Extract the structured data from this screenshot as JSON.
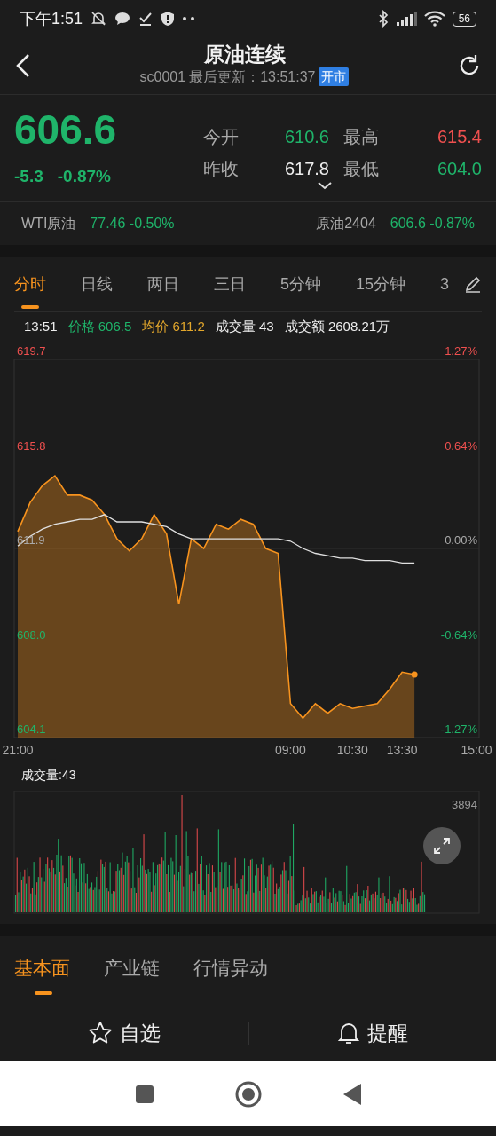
{
  "status_bar": {
    "time": "下午1:51",
    "battery": "56"
  },
  "header": {
    "title": "原油连续",
    "code": "sc0001",
    "update_label": "最后更新：13:51:37",
    "badge": "开市"
  },
  "quote": {
    "price": "606.6",
    "change": "-5.3",
    "change_pct": "-0.87%",
    "color": "#1fb46a",
    "fields": [
      {
        "label": "今开",
        "value": "610.6",
        "color": "#1fb46a"
      },
      {
        "label": "最高",
        "value": "615.4",
        "color": "#f0504f"
      },
      {
        "label": "昨收",
        "value": "617.8",
        "color": "#eeeeee"
      },
      {
        "label": "最低",
        "value": "604.0",
        "color": "#1fb46a"
      }
    ]
  },
  "related": [
    {
      "name": "WTI原油",
      "value": "77.46 -0.50%",
      "color": "#1fb46a"
    },
    {
      "name": "原油2404",
      "value": "606.6 -0.87%",
      "color": "#1fb46a"
    }
  ],
  "period_tabs": [
    {
      "label": "分时",
      "selected": true
    },
    {
      "label": "日线",
      "selected": false
    },
    {
      "label": "两日",
      "selected": false
    },
    {
      "label": "三日",
      "selected": false
    },
    {
      "label": "5分钟",
      "selected": false
    },
    {
      "label": "15分钟",
      "selected": false
    },
    {
      "label": "3",
      "selected": false
    }
  ],
  "info_row": [
    {
      "text": "13:51",
      "kind": "plain"
    },
    {
      "text": "价格 606.5",
      "kind": "price"
    },
    {
      "text": "均价 611.2",
      "kind": "avg"
    },
    {
      "text": "成交量 43",
      "kind": "plain"
    },
    {
      "text": "成交额 2608.21万",
      "kind": "plain"
    }
  ],
  "chart": {
    "right_labels": [
      "1.27%",
      "0.64%",
      "0.00%",
      "-0.64%",
      "-1.27%"
    ],
    "chart_data": {
      "type": "line",
      "grid": true,
      "ylim": [
        604.1,
        619.7
      ],
      "yticks": [
        {
          "value": 619.7,
          "label": "619.7"
        },
        {
          "value": 615.8,
          "label": "615.8"
        },
        {
          "value": 611.9,
          "label": "611.9"
        },
        {
          "value": 608.0,
          "label": "608.0"
        },
        {
          "value": 604.1,
          "label": "604.1"
        }
      ],
      "categories": [
        "21:00",
        null,
        null,
        null,
        null,
        null,
        null,
        null,
        null,
        null,
        null,
        null,
        null,
        null,
        null,
        null,
        null,
        null,
        null,
        null,
        null,
        null,
        "09:00",
        null,
        null,
        null,
        null,
        "10:30",
        null,
        null,
        null,
        "13:30",
        null,
        null,
        null,
        null,
        null,
        "15:00"
      ],
      "series": [
        {
          "color": "#f7931e",
          "values": [
            612.6,
            613.8,
            614.5,
            614.9,
            614.1,
            614.1,
            613.9,
            613.3,
            612.3,
            611.8,
            612.3,
            613.3,
            612.5,
            609.6,
            612.3,
            611.9,
            612.9,
            612.7,
            613.1,
            612.9,
            611.9,
            611.7,
            605.5,
            604.9,
            605.5,
            605.1,
            605.5,
            605.3,
            605.4,
            605.5,
            606.1,
            606.8,
            606.7,
            null,
            null,
            null,
            null,
            null
          ]
        },
        {
          "color": "#e0e0e0",
          "values": [
            612.0,
            612.4,
            612.7,
            612.9,
            613.0,
            613.1,
            613.1,
            613.3,
            613.0,
            613.0,
            613.0,
            612.9,
            612.8,
            612.5,
            612.3,
            612.3,
            612.3,
            612.3,
            612.3,
            612.3,
            612.3,
            612.3,
            612.2,
            611.9,
            611.7,
            611.6,
            611.5,
            611.5,
            611.4,
            611.4,
            611.4,
            611.3,
            611.3,
            null,
            null,
            null,
            null,
            null
          ]
        }
      ]
    }
  },
  "volume": {
    "label": "成交量:43",
    "max_label": "3894"
  },
  "bottom_tabs": [
    {
      "label": "基本面",
      "selected": true
    },
    {
      "label": "产业链",
      "selected": false
    },
    {
      "label": "行情异动",
      "selected": false
    }
  ],
  "actions": [
    {
      "label": "自选",
      "kind": "star"
    },
    {
      "label": "提醒",
      "kind": "bell"
    }
  ]
}
